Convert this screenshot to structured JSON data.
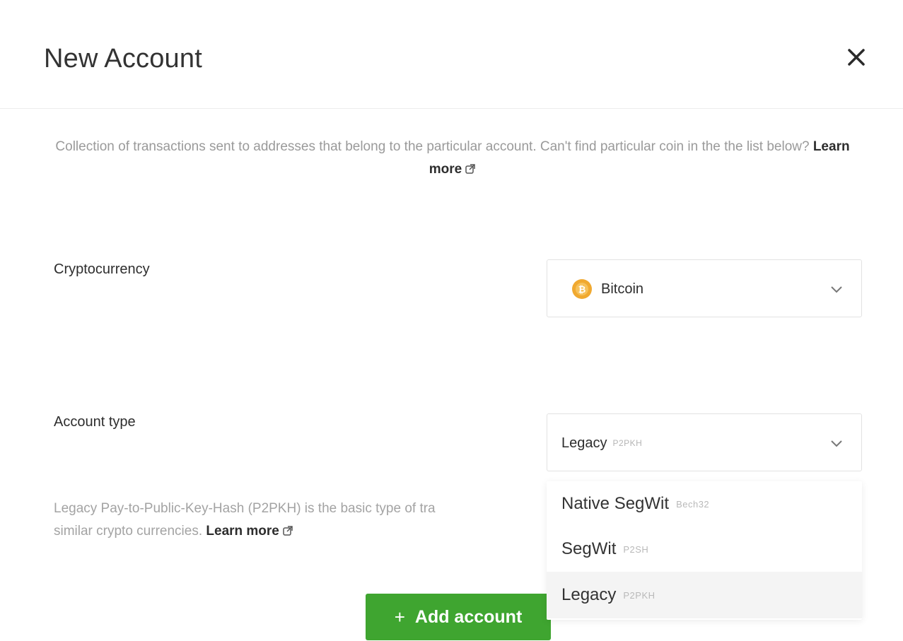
{
  "modal": {
    "title": "New Account",
    "close_icon": "close-icon"
  },
  "description": {
    "text": "Collection of transactions sent to addresses that belong to the particular account. Can't find particular coin in the the list below?",
    "link": "Learn more",
    "link_icon": "external-link-icon"
  },
  "cryptocurrency": {
    "label": "Cryptocurrency",
    "selected": "Bitcoin",
    "icon": "bitcoin-icon",
    "icon_color": "#f0a930"
  },
  "account_type": {
    "label": "Account type",
    "selected": "Legacy",
    "selected_tag": "P2PKH",
    "help_text": "Legacy Pay-to-Public-Key-Hash (P2PKH) is the basic type of tra",
    "help_text_line2": "similar crypto currencies.",
    "help_link": "Learn more",
    "options": [
      {
        "label": "Native SegWit",
        "tag": "Bech32"
      },
      {
        "label": "SegWit",
        "tag": "P2SH"
      },
      {
        "label": "Legacy",
        "tag": "P2PKH"
      }
    ]
  },
  "actions": {
    "add_account": "Add account",
    "add_icon": "plus-icon",
    "accent_color": "#3fa530"
  }
}
